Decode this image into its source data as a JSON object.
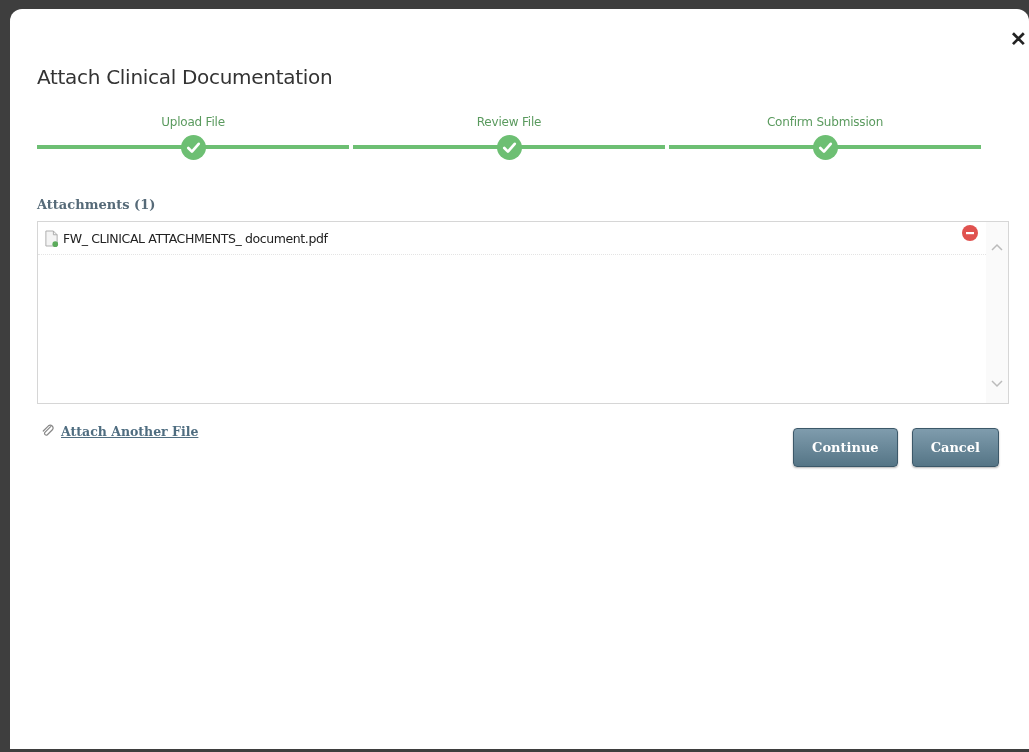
{
  "dialog": {
    "title": "Attach Clinical Documentation",
    "close_label": "✕"
  },
  "steps": [
    {
      "label": "Upload File",
      "completed": true
    },
    {
      "label": "Review File",
      "completed": true
    },
    {
      "label": "Confirm Submission",
      "completed": true
    }
  ],
  "attachments": {
    "heading": "Attachments (1)",
    "files": [
      {
        "name": "FW_ CLINICAL ATTACHMENTS_ document.pdf"
      }
    ]
  },
  "attach_link": "Attach Another File",
  "buttons": [
    "Continue",
    "Cancel"
  ]
}
